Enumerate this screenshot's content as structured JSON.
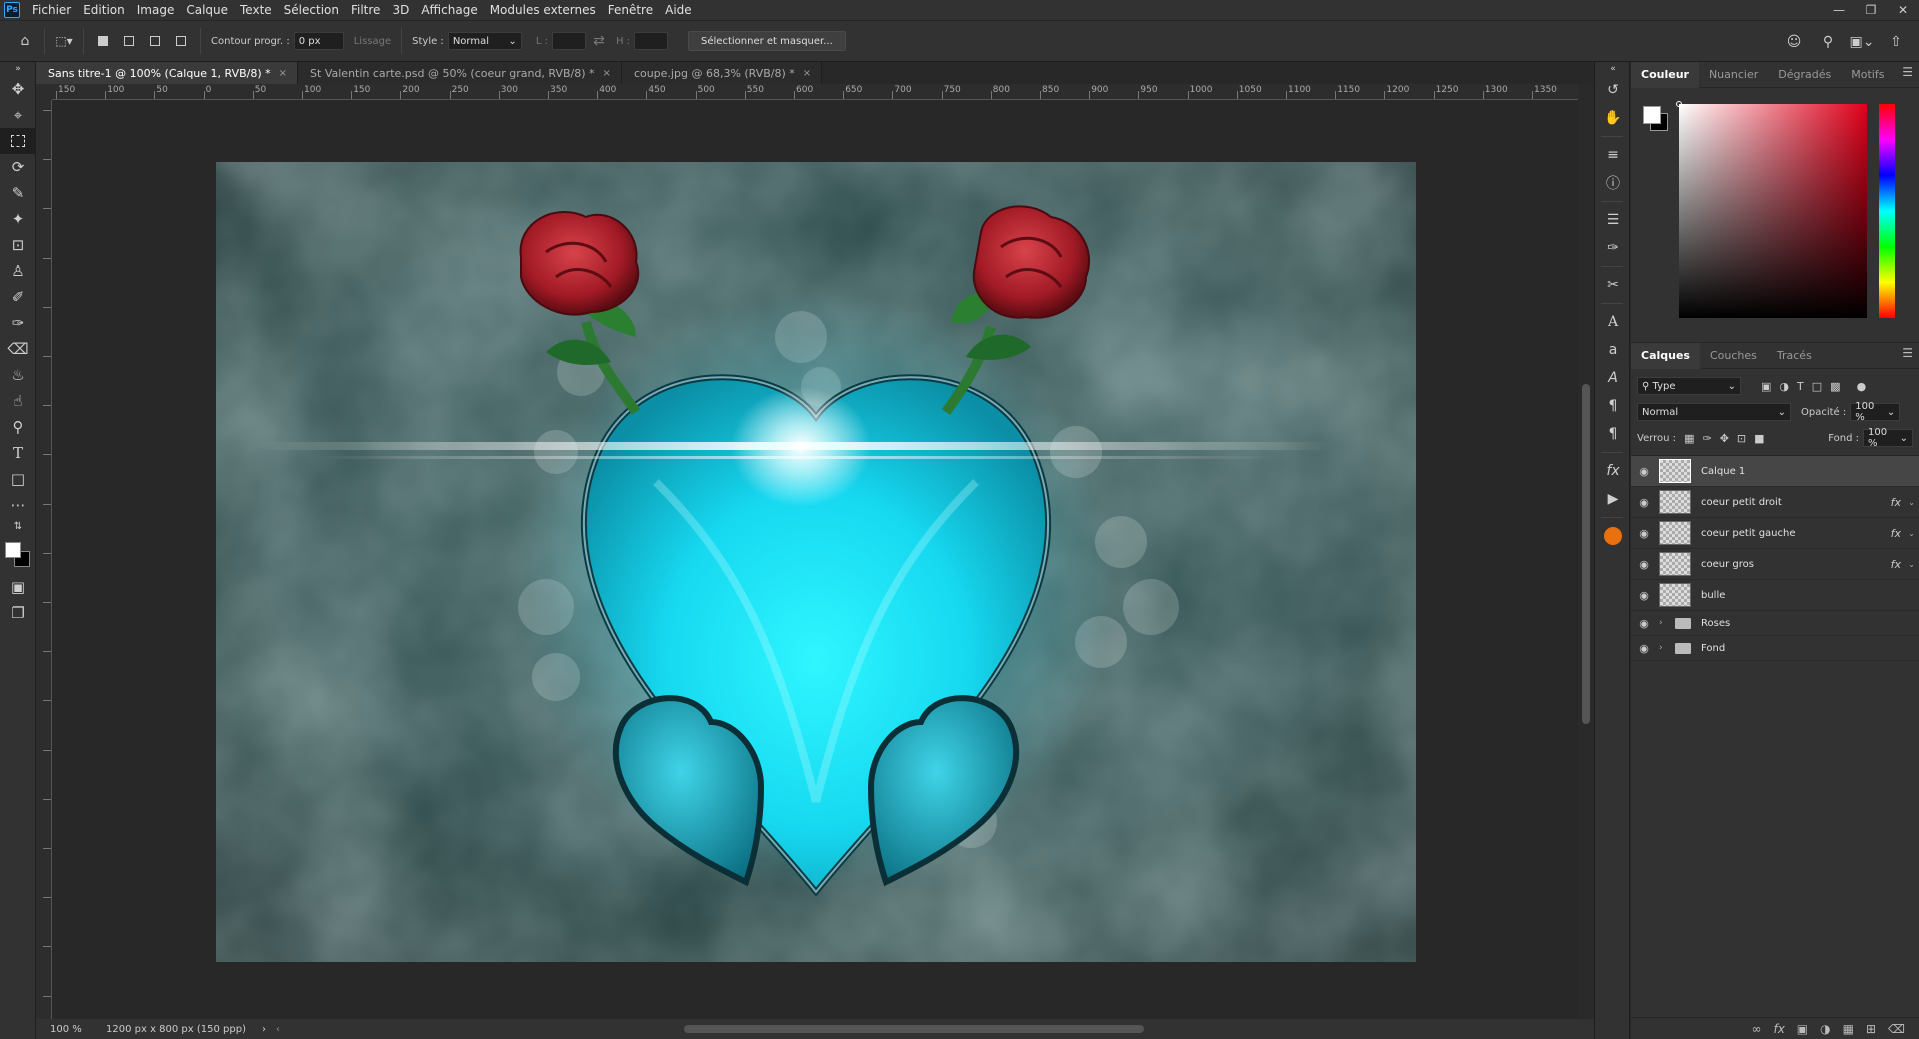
{
  "menubar": {
    "logo": "Ps",
    "items": [
      "Fichier",
      "Edition",
      "Image",
      "Calque",
      "Texte",
      "Sélection",
      "Filtre",
      "3D",
      "Affichage",
      "Modules externes",
      "Fenêtre",
      "Aide"
    ]
  },
  "options": {
    "feather_label": "Contour progr. :",
    "feather_value": "0 px",
    "antialias_label": "Lissage",
    "style_label": "Style :",
    "style_value": "Normal",
    "width_label": "L :",
    "height_label": "H :",
    "select_mask_label": "Sélectionner et masquer..."
  },
  "tabs": [
    {
      "label": "Sans titre-1 @ 100% (Calque 1, RVB/8) *",
      "close": "×"
    },
    {
      "label": "St Valentin carte.psd @ 50% (coeur grand, RVB/8) *",
      "close": "×"
    },
    {
      "label": "coupe.jpg @ 68,3% (RVB/8) *",
      "close": "×"
    }
  ],
  "ruler": {
    "top_labels": [
      "150",
      "100",
      "50",
      "0",
      "50",
      "100",
      "150",
      "200",
      "250",
      "300",
      "350",
      "400",
      "450",
      "500",
      "550",
      "600",
      "650",
      "700",
      "750",
      "800",
      "850",
      "900",
      "950",
      "1000",
      "1050",
      "1100",
      "1150",
      "1200",
      "1250",
      "1300",
      "1350"
    ]
  },
  "status": {
    "zoom": "100 %",
    "doc_info": "1200 px x 800 px (150 ppp)"
  },
  "color_panel": {
    "tabs": [
      "Couleur",
      "Nuancier",
      "Dégradés",
      "Motifs"
    ]
  },
  "layers_panel": {
    "tabs": [
      "Calques",
      "Couches",
      "Tracés"
    ],
    "filter_label": "Type",
    "blend_mode": "Normal",
    "opacity_label": "Opacité :",
    "opacity_value": "100 %",
    "lock_label": "Verrou :",
    "fill_label": "Fond :",
    "fill_value": "100 %",
    "layers": [
      {
        "name": "Calque 1",
        "fx": ""
      },
      {
        "name": "coeur petit droit",
        "fx": "fx"
      },
      {
        "name": "coeur petit gauche",
        "fx": "fx"
      },
      {
        "name": "coeur gros",
        "fx": "fx"
      },
      {
        "name": "bulle",
        "fx": ""
      },
      {
        "name": "Roses",
        "fx": ""
      },
      {
        "name": "Fond",
        "fx": ""
      }
    ]
  },
  "colors": {
    "heart": "#19e6ff",
    "rose": "#b3202c",
    "background": "#2c4a4a"
  }
}
